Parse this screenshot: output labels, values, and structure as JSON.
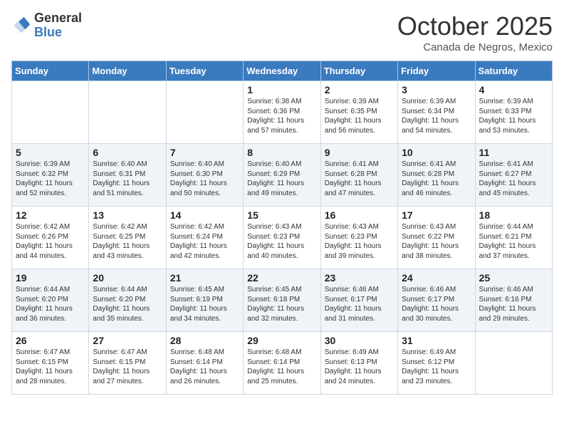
{
  "header": {
    "logo_general": "General",
    "logo_blue": "Blue",
    "month_title": "October 2025",
    "subtitle": "Canada de Negros, Mexico"
  },
  "weekdays": [
    "Sunday",
    "Monday",
    "Tuesday",
    "Wednesday",
    "Thursday",
    "Friday",
    "Saturday"
  ],
  "weeks": [
    [
      {
        "day": "",
        "info": ""
      },
      {
        "day": "",
        "info": ""
      },
      {
        "day": "",
        "info": ""
      },
      {
        "day": "1",
        "info": "Sunrise: 6:38 AM\nSunset: 6:36 PM\nDaylight: 11 hours and 57 minutes."
      },
      {
        "day": "2",
        "info": "Sunrise: 6:39 AM\nSunset: 6:35 PM\nDaylight: 11 hours and 56 minutes."
      },
      {
        "day": "3",
        "info": "Sunrise: 6:39 AM\nSunset: 6:34 PM\nDaylight: 11 hours and 54 minutes."
      },
      {
        "day": "4",
        "info": "Sunrise: 6:39 AM\nSunset: 6:33 PM\nDaylight: 11 hours and 53 minutes."
      }
    ],
    [
      {
        "day": "5",
        "info": "Sunrise: 6:39 AM\nSunset: 6:32 PM\nDaylight: 11 hours and 52 minutes."
      },
      {
        "day": "6",
        "info": "Sunrise: 6:40 AM\nSunset: 6:31 PM\nDaylight: 11 hours and 51 minutes."
      },
      {
        "day": "7",
        "info": "Sunrise: 6:40 AM\nSunset: 6:30 PM\nDaylight: 11 hours and 50 minutes."
      },
      {
        "day": "8",
        "info": "Sunrise: 6:40 AM\nSunset: 6:29 PM\nDaylight: 11 hours and 49 minutes."
      },
      {
        "day": "9",
        "info": "Sunrise: 6:41 AM\nSunset: 6:28 PM\nDaylight: 11 hours and 47 minutes."
      },
      {
        "day": "10",
        "info": "Sunrise: 6:41 AM\nSunset: 6:28 PM\nDaylight: 11 hours and 46 minutes."
      },
      {
        "day": "11",
        "info": "Sunrise: 6:41 AM\nSunset: 6:27 PM\nDaylight: 11 hours and 45 minutes."
      }
    ],
    [
      {
        "day": "12",
        "info": "Sunrise: 6:42 AM\nSunset: 6:26 PM\nDaylight: 11 hours and 44 minutes."
      },
      {
        "day": "13",
        "info": "Sunrise: 6:42 AM\nSunset: 6:25 PM\nDaylight: 11 hours and 43 minutes."
      },
      {
        "day": "14",
        "info": "Sunrise: 6:42 AM\nSunset: 6:24 PM\nDaylight: 11 hours and 42 minutes."
      },
      {
        "day": "15",
        "info": "Sunrise: 6:43 AM\nSunset: 6:23 PM\nDaylight: 11 hours and 40 minutes."
      },
      {
        "day": "16",
        "info": "Sunrise: 6:43 AM\nSunset: 6:23 PM\nDaylight: 11 hours and 39 minutes."
      },
      {
        "day": "17",
        "info": "Sunrise: 6:43 AM\nSunset: 6:22 PM\nDaylight: 11 hours and 38 minutes."
      },
      {
        "day": "18",
        "info": "Sunrise: 6:44 AM\nSunset: 6:21 PM\nDaylight: 11 hours and 37 minutes."
      }
    ],
    [
      {
        "day": "19",
        "info": "Sunrise: 6:44 AM\nSunset: 6:20 PM\nDaylight: 11 hours and 36 minutes."
      },
      {
        "day": "20",
        "info": "Sunrise: 6:44 AM\nSunset: 6:20 PM\nDaylight: 11 hours and 35 minutes."
      },
      {
        "day": "21",
        "info": "Sunrise: 6:45 AM\nSunset: 6:19 PM\nDaylight: 11 hours and 34 minutes."
      },
      {
        "day": "22",
        "info": "Sunrise: 6:45 AM\nSunset: 6:18 PM\nDaylight: 11 hours and 32 minutes."
      },
      {
        "day": "23",
        "info": "Sunrise: 6:46 AM\nSunset: 6:17 PM\nDaylight: 11 hours and 31 minutes."
      },
      {
        "day": "24",
        "info": "Sunrise: 6:46 AM\nSunset: 6:17 PM\nDaylight: 11 hours and 30 minutes."
      },
      {
        "day": "25",
        "info": "Sunrise: 6:46 AM\nSunset: 6:16 PM\nDaylight: 11 hours and 29 minutes."
      }
    ],
    [
      {
        "day": "26",
        "info": "Sunrise: 6:47 AM\nSunset: 6:15 PM\nDaylight: 11 hours and 28 minutes."
      },
      {
        "day": "27",
        "info": "Sunrise: 6:47 AM\nSunset: 6:15 PM\nDaylight: 11 hours and 27 minutes."
      },
      {
        "day": "28",
        "info": "Sunrise: 6:48 AM\nSunset: 6:14 PM\nDaylight: 11 hours and 26 minutes."
      },
      {
        "day": "29",
        "info": "Sunrise: 6:48 AM\nSunset: 6:14 PM\nDaylight: 11 hours and 25 minutes."
      },
      {
        "day": "30",
        "info": "Sunrise: 6:49 AM\nSunset: 6:13 PM\nDaylight: 11 hours and 24 minutes."
      },
      {
        "day": "31",
        "info": "Sunrise: 6:49 AM\nSunset: 6:12 PM\nDaylight: 11 hours and 23 minutes."
      },
      {
        "day": "",
        "info": ""
      }
    ]
  ]
}
